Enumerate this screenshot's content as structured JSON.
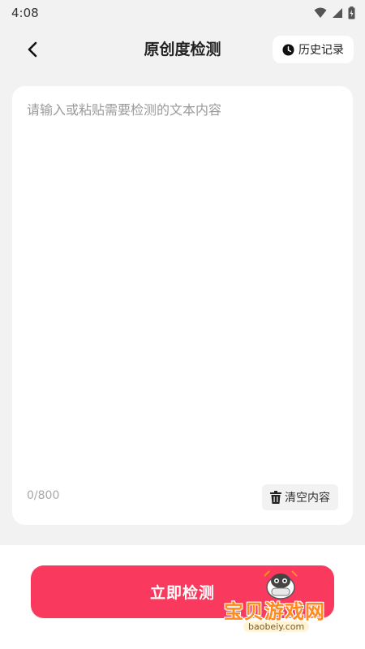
{
  "status_bar": {
    "time": "4:08",
    "icons": [
      "wifi-icon",
      "signal-icon",
      "battery-icon"
    ]
  },
  "header": {
    "title": "原创度检测",
    "back_icon": "chevron-left-icon",
    "history_label": "历史记录",
    "history_icon": "clock-icon"
  },
  "editor": {
    "value": "",
    "placeholder": "请输入或粘贴需要检测的文本内容",
    "char_count": "0/800",
    "clear_label": "清空内容",
    "clear_icon": "trash-icon"
  },
  "actions": {
    "detect_label": "立即检测"
  },
  "watermark": {
    "text": "宝贝游戏网",
    "url": "baobeiy.com"
  },
  "colors": {
    "accent": "#f93a5e",
    "background": "#f2f2f2",
    "card": "#ffffff",
    "placeholder": "#9a9a9a"
  }
}
